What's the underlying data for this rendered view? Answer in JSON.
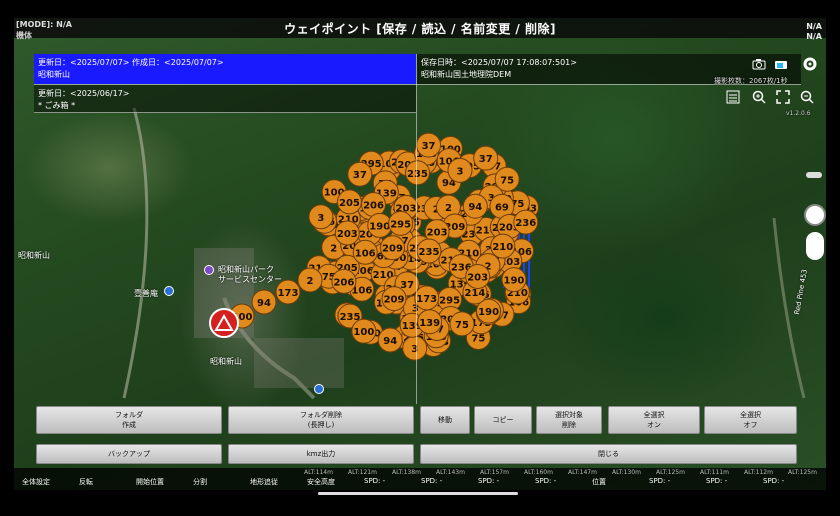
{
  "status": {
    "mode_label": "[MODE]: N/A",
    "sub_label": "機体",
    "na_right_1": "N/A",
    "na_right_2": "N/A"
  },
  "title": "ウェイポイント [保存 / 読込 / 名前変更 / 削除]",
  "folders": [
    {
      "dates": "更新日：<2025/07/07> 作成日：<2025/07/07>",
      "name": "昭和新山",
      "selected": true
    },
    {
      "dates": "更新日：<2025/06/17>",
      "name": "* ごみ箱 *",
      "selected": false
    }
  ],
  "file_panel": {
    "saved": "保存日時：<2025/07/07 17:08:07:501>",
    "name": "昭和新山国土地理院DEM"
  },
  "shot_count": "撮影枚数：2067枚/1秒",
  "version": "v1.2.0.6",
  "map_labels": {
    "showa": "昭和新山",
    "park": "昭和新山パーク",
    "service": "サービスセンター",
    "temple": "壹善庵",
    "showa2": "昭和新山",
    "road": "Red Pine 453",
    "river": "昭和新山"
  },
  "markers": {
    "visible_numbers": [
      "3",
      "37",
      "69",
      "106",
      "139",
      "190",
      "205",
      "209",
      "210",
      "214",
      "295",
      "203",
      "206",
      "236",
      "235",
      "37",
      "75",
      "100",
      "94",
      "173",
      "2",
      "100"
    ],
    "home_label": "H"
  },
  "buttons": {
    "folder_create": [
      "フォルダ",
      "作成"
    ],
    "folder_delete": [
      "フォルダ削除",
      "(長押し)"
    ],
    "move": "移動",
    "copy": "コピー",
    "delete_selected": [
      "選択対象",
      "削除"
    ],
    "select_all_on": [
      "全選択",
      "オン"
    ],
    "select_all_off": [
      "全選択",
      "オフ"
    ],
    "backup": "バックアップ",
    "kmz": "kmz出力",
    "close": "閉じる"
  },
  "bottom_nav": {
    "items": [
      "全体設定",
      "反転",
      "開始位置",
      "分割",
      "地形追従",
      "安全高度",
      "SPD: -",
      "SPD: -",
      "SPD: -",
      "SPD: -",
      "位置",
      "SPD: -",
      "SPD: -",
      "SPD: -"
    ],
    "alts": [
      "ALT:114m",
      "ALT:121m",
      "ALT:138m",
      "ALT:143m",
      "ALT:157m",
      "ALT:160m",
      "ALT:147m",
      "ALT:130m",
      "ALT:125m",
      "ALT:111m",
      "ALT:112m",
      "ALT:125m"
    ]
  },
  "colors": {
    "marker": "#e08a1e",
    "marker_border": "#6a3b08",
    "selected_panel": "#1a1aff",
    "home": "#d42020"
  }
}
